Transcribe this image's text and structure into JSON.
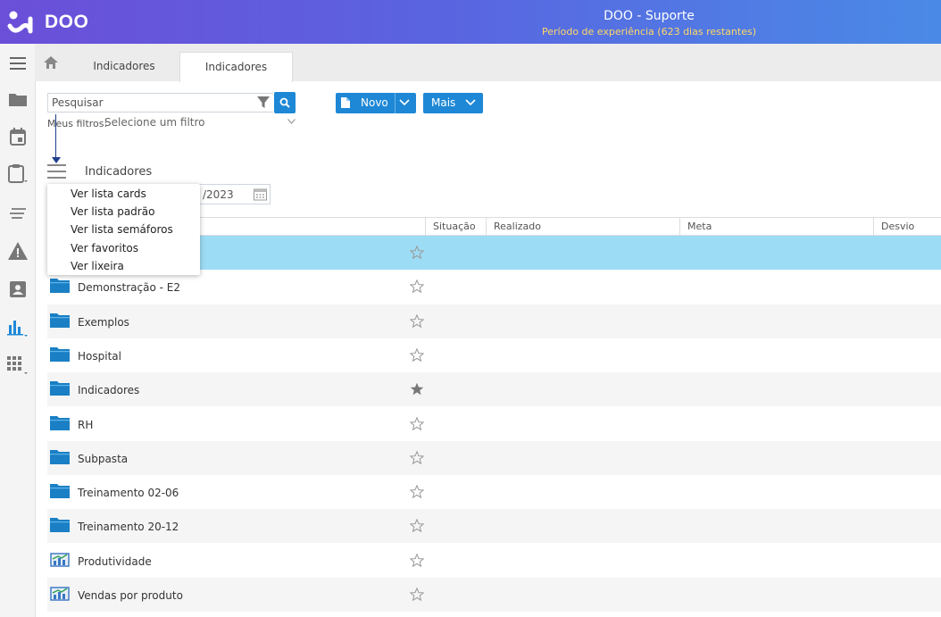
{
  "header": {
    "brand": "DOO",
    "title": "DOO - Suporte",
    "subtitle": "Período de experiência (623 dias restantes)"
  },
  "tabs": [
    {
      "label": "Indicadores"
    },
    {
      "label": "Indicadores"
    }
  ],
  "search": {
    "placeholder": "Pesquisar"
  },
  "filters": {
    "label": "Meus filtros:",
    "value": "Selecione um filtro"
  },
  "toolbar": {
    "novo": "Novo",
    "mais": "Mais"
  },
  "section": {
    "title": "Indicadores"
  },
  "date_partial": "/2023",
  "view_menu": [
    "Ver lista cards",
    "Ver lista padrão",
    "Ver lista semáforos",
    "Ver favoritos",
    "Ver lixeira"
  ],
  "columns": [
    "Situação",
    "Realizado",
    "Meta",
    "Desvio"
  ],
  "rows": [
    {
      "name": "",
      "icon": "folder-icon",
      "favorite": false,
      "highlighted": true
    },
    {
      "name": "Demonstração - E2",
      "icon": "folder-icon",
      "favorite": false
    },
    {
      "name": "Exemplos",
      "icon": "folder-icon",
      "favorite": false
    },
    {
      "name": "Hospital",
      "icon": "folder-icon",
      "favorite": false
    },
    {
      "name": "Indicadores",
      "icon": "folder-icon",
      "favorite": true
    },
    {
      "name": "RH",
      "icon": "folder-icon",
      "favorite": false
    },
    {
      "name": "Subpasta",
      "icon": "folder-icon",
      "favorite": false
    },
    {
      "name": "Treinamento 02-06",
      "icon": "folder-icon",
      "favorite": false
    },
    {
      "name": "Treinamento 20-12",
      "icon": "folder-icon",
      "favorite": false
    },
    {
      "name": "Produtividade",
      "icon": "indicator-chart-icon",
      "favorite": false
    },
    {
      "name": "Vendas por produto",
      "icon": "indicator-chart-icon",
      "favorite": false
    }
  ],
  "colors": {
    "accent": "#1e88d6",
    "highlight_row": "#9ddcf5",
    "folder": "#1a7fc4",
    "subtitle": "#ffd866"
  }
}
